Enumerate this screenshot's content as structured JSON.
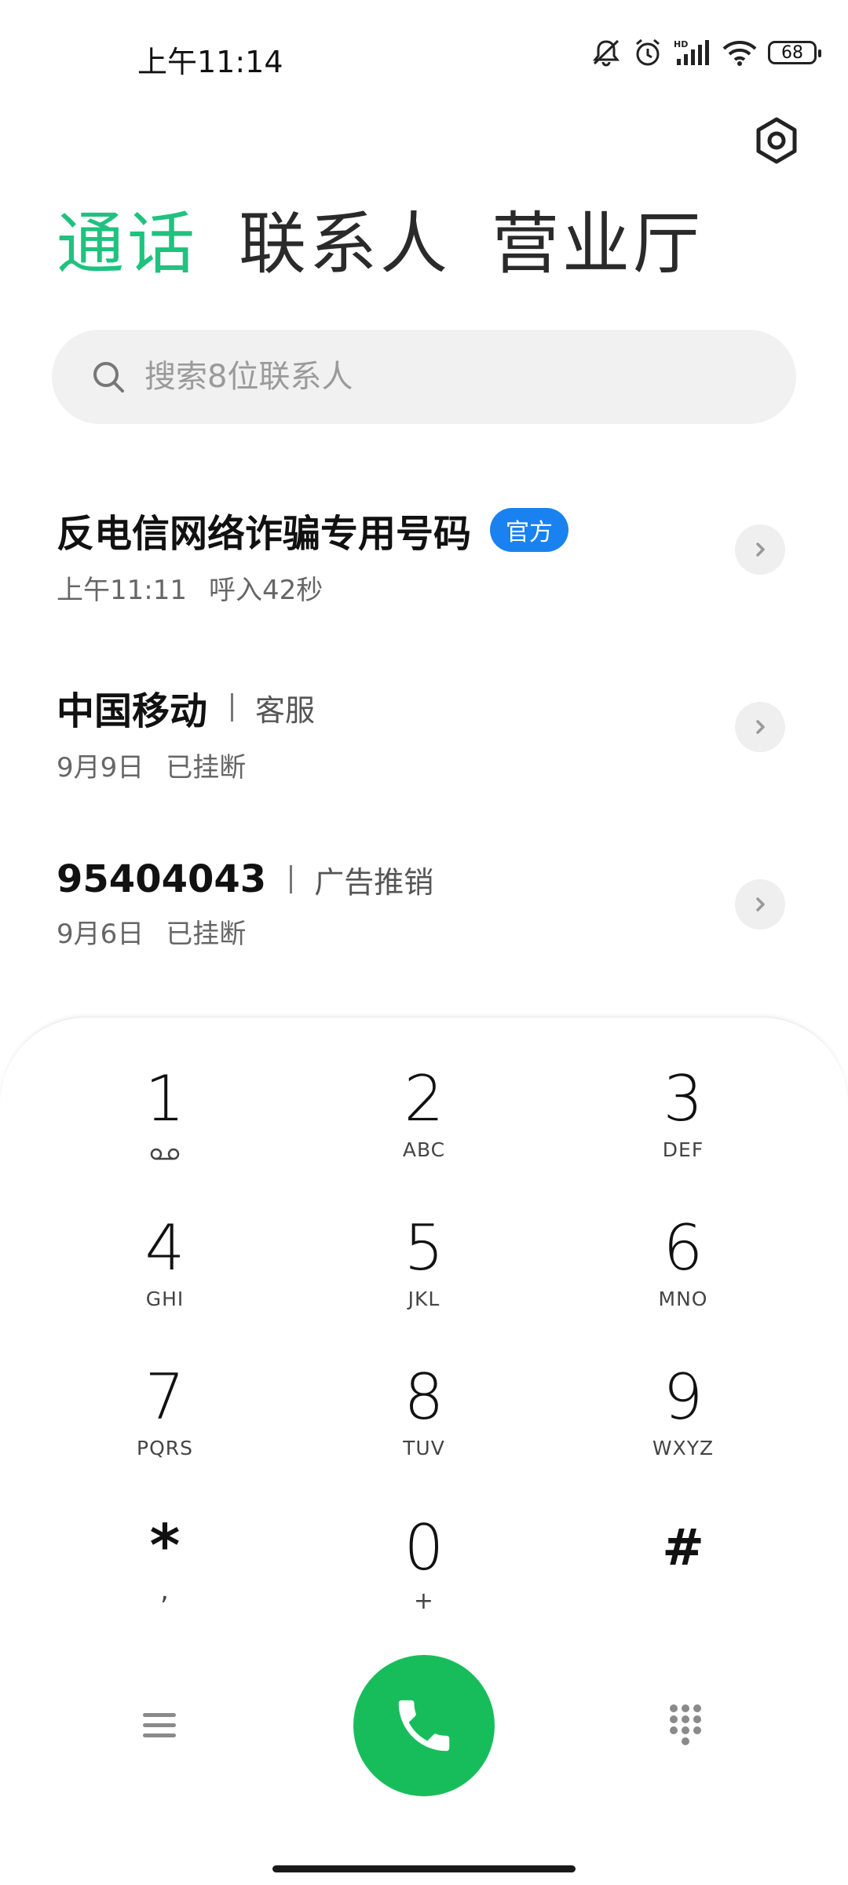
{
  "status_bar": {
    "time": "上午11:14",
    "battery": "68",
    "icons": [
      "mute-icon",
      "alarm-icon",
      "hd-signal-icon",
      "wifi-icon",
      "battery-icon"
    ]
  },
  "tabs": [
    {
      "label": "通话",
      "active": true
    },
    {
      "label": "联系人",
      "active": false
    },
    {
      "label": "营业厅",
      "active": false
    }
  ],
  "search": {
    "placeholder": "搜索8位联系人"
  },
  "calls": [
    {
      "name": "反电信网络诈骗专用号码",
      "badge": "官方",
      "date": "上午11:11",
      "detail": "呼入42秒"
    },
    {
      "name": "中国移动",
      "tag": "客服",
      "date": "9月9日",
      "detail": "已挂断"
    },
    {
      "name": "95404043",
      "tag": "广告推销",
      "date": "9月6日",
      "detail": "已挂断"
    }
  ],
  "dialpad": {
    "keys": [
      {
        "digit": "1",
        "letters": ""
      },
      {
        "digit": "2",
        "letters": "ABC"
      },
      {
        "digit": "3",
        "letters": "DEF"
      },
      {
        "digit": "4",
        "letters": "GHI"
      },
      {
        "digit": "5",
        "letters": "JKL"
      },
      {
        "digit": "6",
        "letters": "MNO"
      },
      {
        "digit": "7",
        "letters": "PQRS"
      },
      {
        "digit": "8",
        "letters": "TUV"
      },
      {
        "digit": "9",
        "letters": "WXYZ"
      },
      {
        "digit": "*",
        "letters": ","
      },
      {
        "digit": "0",
        "letters": "+"
      },
      {
        "digit": "#",
        "letters": ""
      }
    ]
  },
  "colors": {
    "accent": "#1fc27f",
    "call_button": "#17bd5a",
    "badge": "#1a82f0"
  }
}
